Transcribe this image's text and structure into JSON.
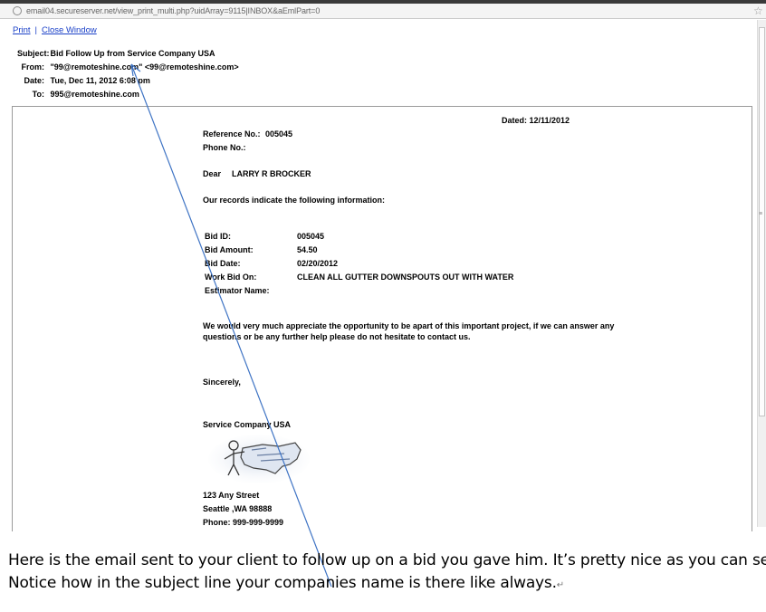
{
  "browser": {
    "url": "email04.secureserver.net/view_print_multi.php?uidArray=9115|INBOX&aEmlPart=0"
  },
  "toolbar": {
    "print_label": "Print",
    "separator": "|",
    "close_label": "Close Window"
  },
  "header": {
    "subject_label": "Subject:",
    "subject": "Bid Follow Up from Service Company USA",
    "from_label": "From:",
    "from": "\"99@remoteshine.com\" <99@remoteshine.com>",
    "date_label": "Date:",
    "date": "Tue, Dec 11, 2012 6:08 pm",
    "to_label": "To:",
    "to": "995@remoteshine.com"
  },
  "letter": {
    "dated": "Dated: 12/11/2012",
    "reference_label": "Reference No.:",
    "reference_value": "005045",
    "phone_label": "Phone No.:",
    "dear": "Dear",
    "recipient": "LARRY R BROCKER",
    "intro": "Our records indicate the following information:",
    "bid_id_label": "Bid ID:",
    "bid_id_value": "005045",
    "bid_amount_label": "Bid Amount:",
    "bid_amount_value": "54.50",
    "bid_date_label": "Bid Date:",
    "bid_date_value": "02/20/2012",
    "work_label": "Work Bid On:",
    "work_value": "CLEAN ALL GUTTER DOWNSPOUTS OUT WITH WATER",
    "estimator_label": "Estimator Name:",
    "body_line1": "We would very much appreciate the opportunity to be apart of this important project, if we can answer any",
    "body_line2": "questions or be any further help please do not hesitate to contact us.",
    "closing": "Sincerely,",
    "company": "Service Company USA",
    "address1": "123 Any Street",
    "address2": "Seattle ,WA 98888",
    "phone": "Phone:  999-999-9999"
  },
  "caption": {
    "line1": "Here is the email sent to your client to follow up on a bid you gave him. It’s pretty nice as you can see..",
    "line2": "Notice how in the subject line your companies name is there like always."
  },
  "colors": {
    "link": "#1a40c8",
    "annotation_line": "#3f74c4"
  }
}
